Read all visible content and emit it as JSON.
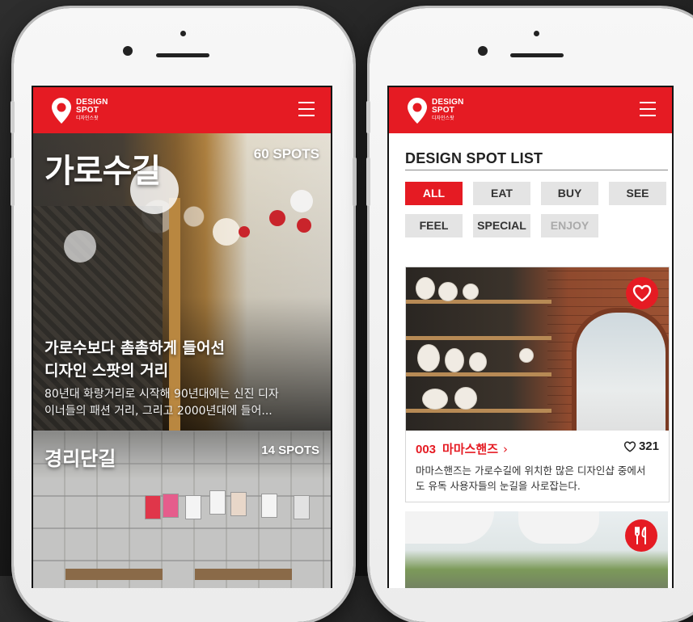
{
  "brand": {
    "line1": "DESIGN",
    "line2": "SPOT",
    "line3": "디자인스팟",
    "accent_color": "#e51b23"
  },
  "left_screen": {
    "cards": [
      {
        "title": "가로수길",
        "spots": "60 SPOTS",
        "headline_1": "가로수보다 촘촘하게 들어선",
        "headline_2": "디자인 스팟의 거리",
        "excerpt_1": "80년대 화랑거리로 시작해 90년대에는 신진 디자",
        "excerpt_2": "이너들의 패션 거리, 그리고 2000년대에 들어..."
      },
      {
        "title": "경리단길",
        "spots": "14 SPOTS"
      }
    ]
  },
  "right_screen": {
    "list_title": "DESIGN SPOT LIST",
    "filters": [
      "ALL",
      "EAT",
      "BUY",
      "SEE",
      "FEEL",
      "SPECIAL",
      "ENJOY"
    ],
    "active_filter": "ALL",
    "spot": {
      "number": "003",
      "name": "마마스핸즈",
      "chevron": "›",
      "likes": "321",
      "desc_1": "마마스핸즈는 가로수길에 위치한 많은 디자인샵 중에서",
      "desc_2": "도 유독 사용자들의 눈길을 사로잡는다.",
      "badge_icon": "heart-icon"
    },
    "next_spot": {
      "badge_icon": "fork-knife-icon"
    }
  }
}
